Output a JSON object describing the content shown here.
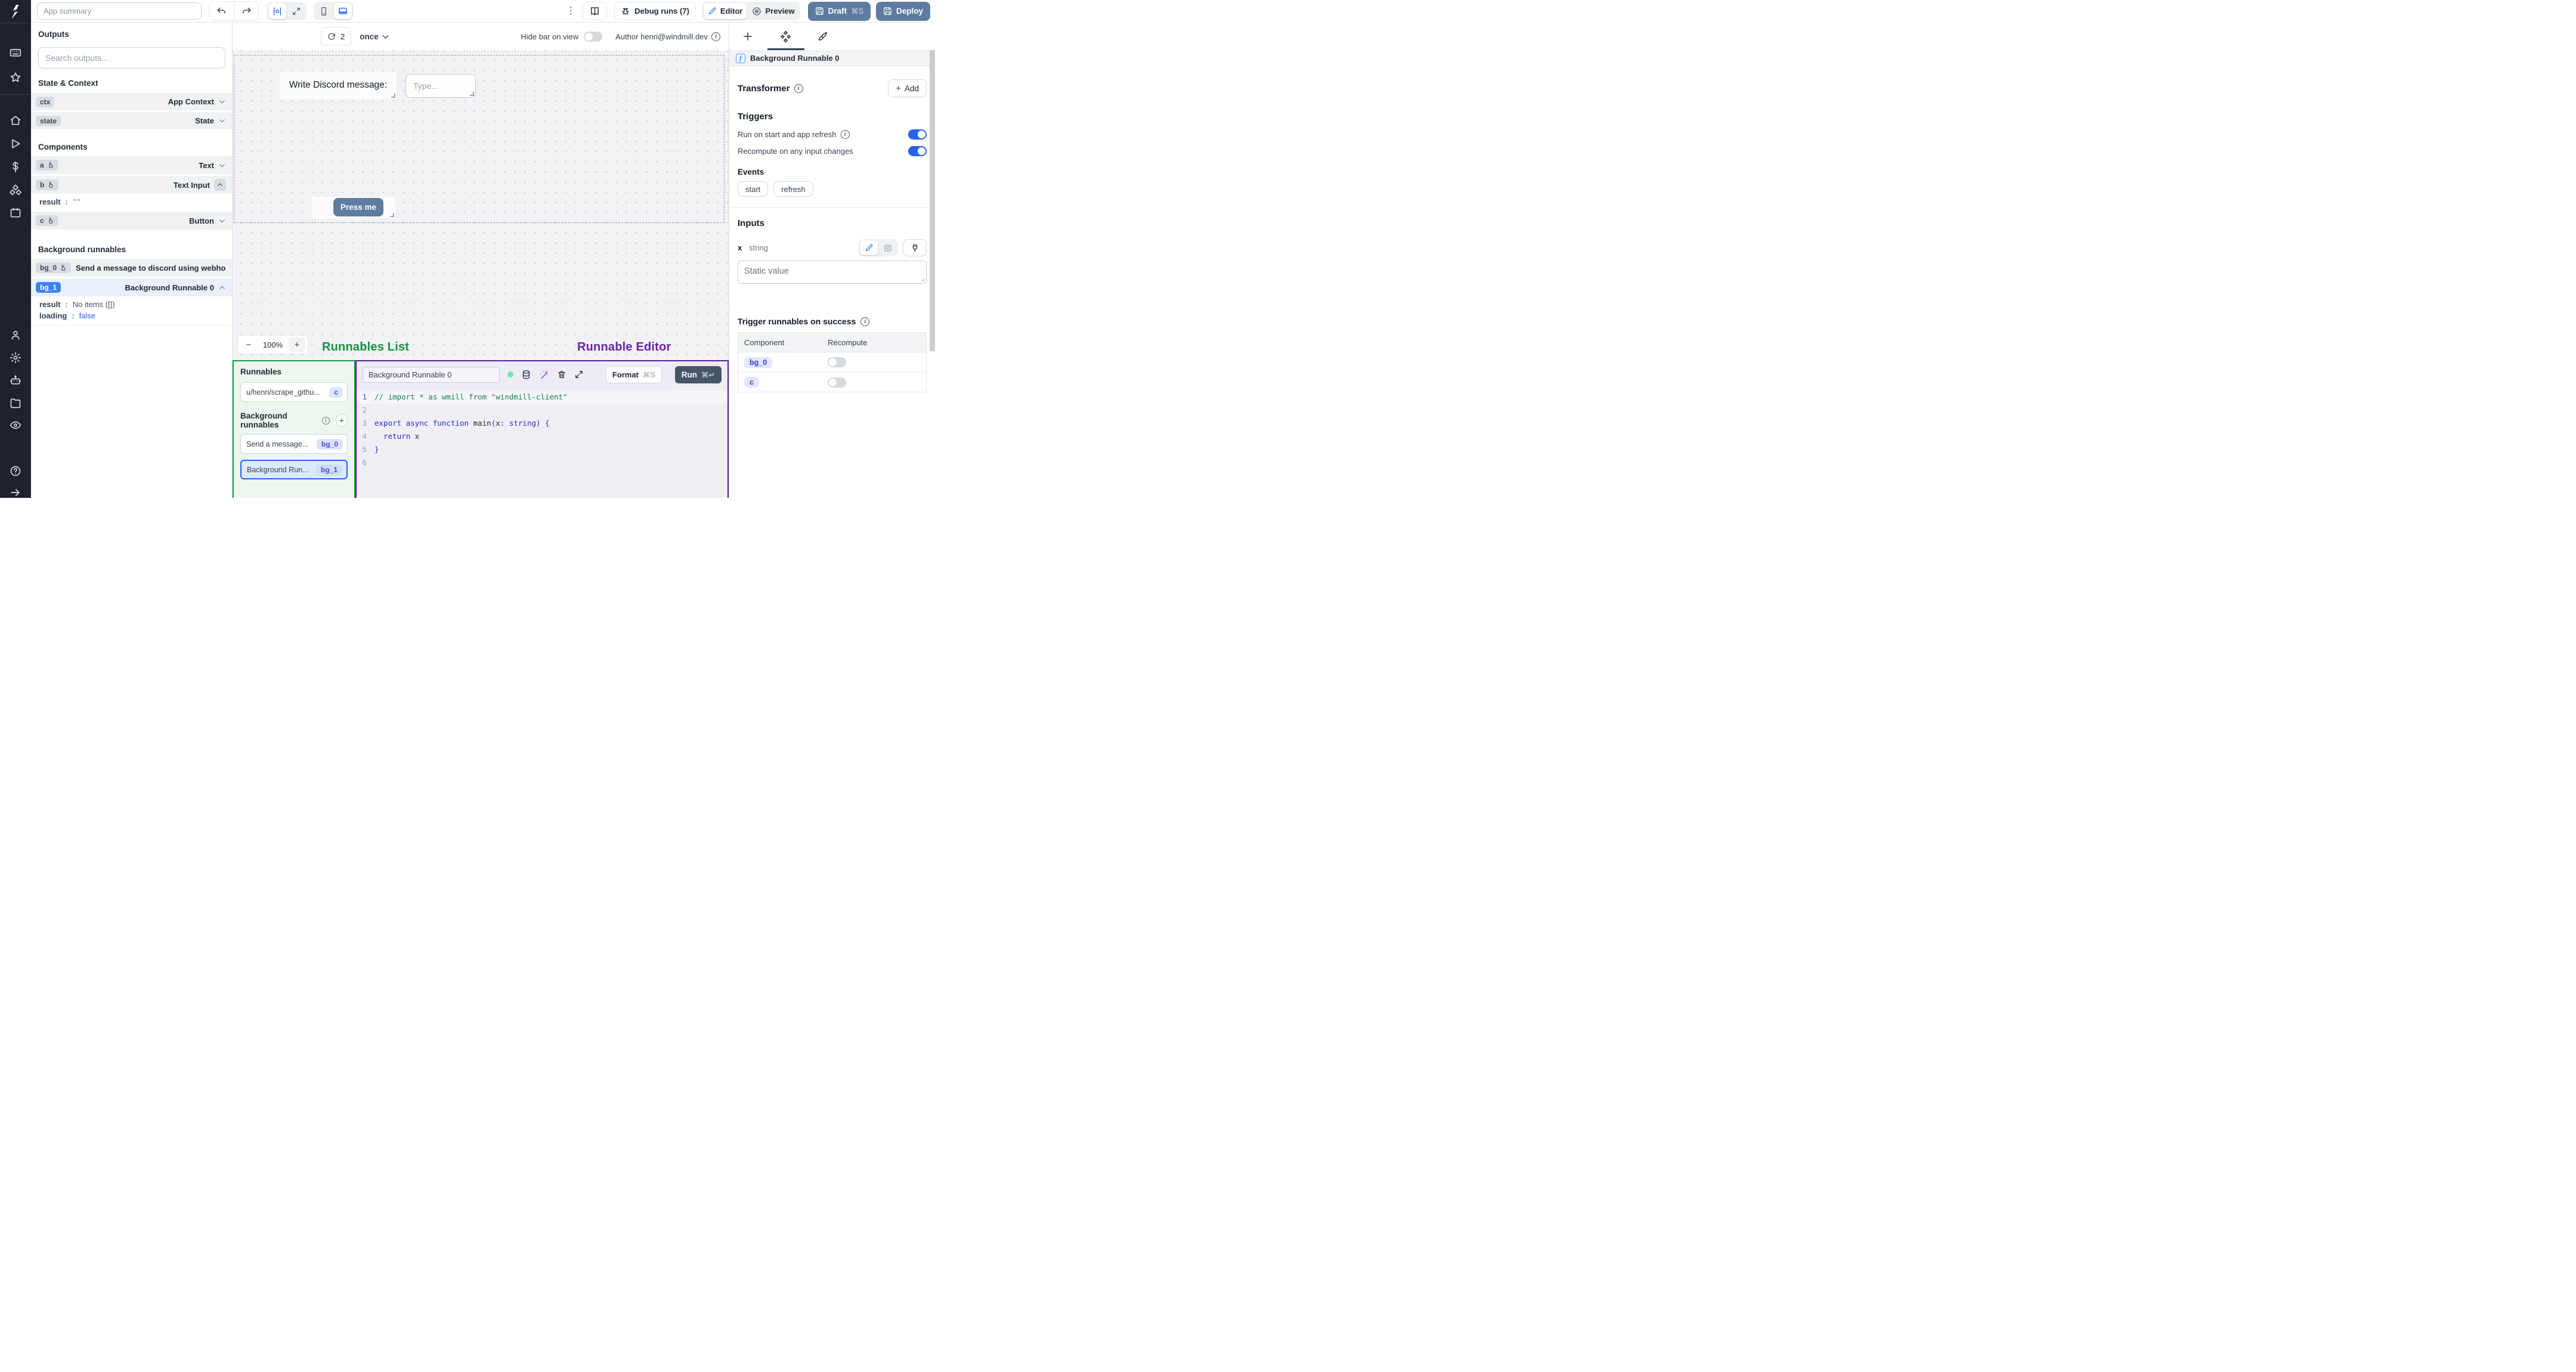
{
  "topbar": {
    "app_summary_placeholder": "App summary",
    "debug_runs_label": "Debug runs (7)",
    "editor_label": "Editor",
    "preview_label": "Preview",
    "draft_label": "Draft",
    "draft_shortcut": "⌘S",
    "deploy_label": "Deploy"
  },
  "canvas_toolbar": {
    "refresh_count": "2",
    "frequency": "once",
    "hide_bar_label": "Hide bar on view",
    "author_label": "Author henri@windmill.dev"
  },
  "outputs_panel": {
    "title": "Outputs",
    "search_placeholder": "Search outputs...",
    "state_context_title": "State & Context",
    "ctx_id": "ctx",
    "ctx_type": "App Context",
    "state_id": "state",
    "state_type": "State",
    "components_title": "Components",
    "a_id": "a",
    "a_type": "Text",
    "b_id": "b",
    "b_type": "Text Input",
    "b_result_key": "result",
    "b_result_val": "\"\"",
    "c_id": "c",
    "c_type": "Button",
    "bg_title": "Background runnables",
    "bg0_id": "bg_0",
    "bg0_label": "Send a message to discord using webhoo",
    "bg1_id": "bg_1",
    "bg1_label": "Background Runnable 0",
    "bg1_result_key": "result",
    "bg1_result_val": "No items ([])",
    "bg1_loading_key": "loading",
    "bg1_loading_val": "false"
  },
  "canvas": {
    "label_text": "Write Discord message:",
    "input_placeholder": "Type...",
    "button_text": "Press me",
    "zoom_value": "100%",
    "zoom_minus": "−",
    "zoom_plus": "+"
  },
  "annotations": {
    "runnables_list": "Runnables List",
    "runnable_editor": "Runnable Editor"
  },
  "runnables_panel": {
    "title": "Runnables",
    "item1_label": "u/henri/scrape_githu...",
    "item1_badge": "c",
    "bg_title": "Background runnables",
    "item2_label": "Send a message...",
    "item2_badge": "bg_0",
    "item3_label": "Background Run...",
    "item3_badge": "bg_1",
    "add_glyph": "+"
  },
  "editor_panel": {
    "name_value": "Background Runnable 0",
    "format_label": "Format",
    "format_shortcut": "⌘S",
    "run_label": "Run",
    "run_shortcut": "⌘↵",
    "active_line": 0,
    "code_lines": [
      [
        {
          "t": "// import * as wmill from \"windmill-client\"",
          "c": "com"
        }
      ],
      [],
      [
        {
          "t": "export",
          "c": "kw"
        },
        {
          "t": " ",
          "c": "pl"
        },
        {
          "t": "async",
          "c": "kw"
        },
        {
          "t": " ",
          "c": "pl"
        },
        {
          "t": "function",
          "c": "kw"
        },
        {
          "t": " ",
          "c": "pl"
        },
        {
          "t": "main",
          "c": "fn"
        },
        {
          "t": "(",
          "c": "pn"
        },
        {
          "t": "x",
          "c": "id"
        },
        {
          "t": ": ",
          "c": "pn"
        },
        {
          "t": "string",
          "c": "kw"
        },
        {
          "t": ") {",
          "c": "pn"
        }
      ],
      [
        {
          "t": "  ",
          "c": "pl"
        },
        {
          "t": "return",
          "c": "kw"
        },
        {
          "t": " x",
          "c": "id"
        }
      ],
      [
        {
          "t": "}",
          "c": "pn"
        }
      ],
      []
    ]
  },
  "right_panel": {
    "selected_runnable": "Background Runnable 0",
    "transformer_title": "Transformer",
    "add_label": "Add",
    "triggers_title": "Triggers",
    "run_on_start_label": "Run on start and app refresh",
    "recompute_label": "Recompute on any input changes",
    "events_title": "Events",
    "event_start": "start",
    "event_refresh": "refresh",
    "inputs_title": "Inputs",
    "input_name": "x",
    "input_type": "string",
    "static_placeholder": "Static value",
    "trigger_success_title": "Trigger runnables on success",
    "table_col1": "Component",
    "table_col2": "Recompute",
    "table_row1_id": "bg_0",
    "table_row2_id": "c"
  },
  "colors": {
    "accent_blue": "#2563eb",
    "slate_button": "#5e7ca0",
    "run_button": "#475569",
    "annotation_green": "#16913f",
    "annotation_purple": "#6b21a8",
    "panel_green_border": "#169a46",
    "panel_purple_border": "#5b1e8f",
    "badge_indigo_text": "#4f46e5",
    "rail_bg": "#1e222b",
    "code_comment": "#188649",
    "code_keyword": "#2a2ad6"
  }
}
